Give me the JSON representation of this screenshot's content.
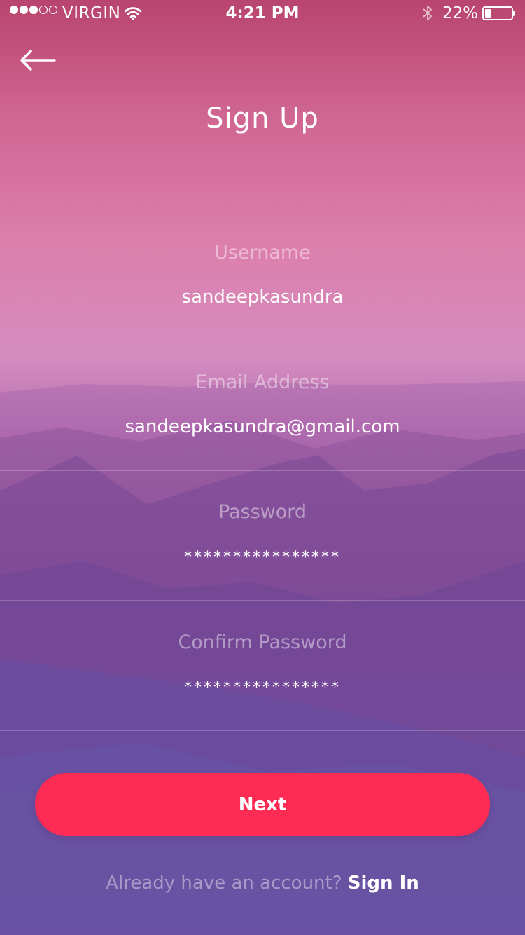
{
  "status_bar": {
    "carrier": "VIRGIN",
    "time": "4:21 PM",
    "battery": "22%",
    "battery_level": 0.22,
    "signal_bars_filled": 3,
    "signal_bars_total": 5
  },
  "header": {
    "title": "Sign Up",
    "back_icon": "arrow-left-icon"
  },
  "form": {
    "fields": [
      {
        "label": "Username",
        "value": "sandeepkasundra"
      },
      {
        "label": "Email Address",
        "value": "sandeepkasundra@gmail.com"
      },
      {
        "label": "Password",
        "value": "****************"
      },
      {
        "label": "Confirm Password",
        "value": "****************"
      }
    ]
  },
  "actions": {
    "next_label": "Next"
  },
  "footer": {
    "prompt": "Already have an account?",
    "link": "Sign In"
  },
  "colors": {
    "accent": "#fe2b55",
    "gradient_top": "#b8456e",
    "gradient_bottom": "#6d68b8"
  }
}
